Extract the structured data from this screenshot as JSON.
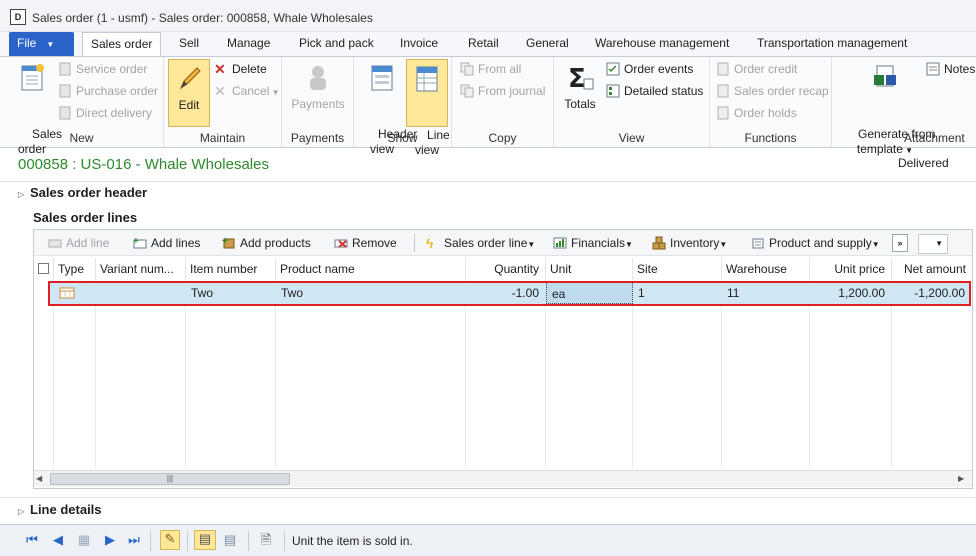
{
  "window": {
    "title": "Sales order (1 - usmf) - Sales order: 000858, Whale Wholesales",
    "app_icon": "ax-app-icon"
  },
  "tabs": [
    "File",
    "Sales order",
    "Sell",
    "Manage",
    "Pick and pack",
    "Invoice",
    "Retail",
    "General",
    "Warehouse management",
    "Transportation management"
  ],
  "ribbon": {
    "new": {
      "label": "New",
      "sales_order": "Sales\norder",
      "service_order": "Service order",
      "purchase_order": "Purchase order",
      "direct_delivery": "Direct delivery"
    },
    "maintain": {
      "label": "Maintain",
      "edit": "Edit",
      "delete": "Delete",
      "cancel": "Cancel"
    },
    "payments": {
      "label": "Payments",
      "payments": "Payments"
    },
    "show": {
      "label": "Show",
      "header_view": "Header\nview",
      "line_view": "Line\nview"
    },
    "copy": {
      "label": "Copy",
      "from_all": "From all",
      "from_journal": "From journal"
    },
    "view": {
      "label": "View",
      "totals": "Totals",
      "order_events": "Order events",
      "detailed_status": "Detailed status"
    },
    "functions": {
      "label": "Functions",
      "order_credit": "Order credit",
      "sales_order_recap": "Sales order recap",
      "order_holds": "Order holds"
    },
    "attachments": {
      "label": "Attachment",
      "generate": "Generate from\ntemplate",
      "notes": "Notes"
    }
  },
  "form": {
    "title": "000858 : US-016 - Whale Wholesales",
    "status": "Delivered",
    "header_section": "Sales order header",
    "lines_section": "Sales order lines",
    "line_details": "Line details"
  },
  "lines_toolbar": {
    "add_line": "Add line",
    "add_lines": "Add lines",
    "add_products": "Add products",
    "remove": "Remove",
    "sales_order_line": "Sales order line",
    "financials": "Financials",
    "inventory": "Inventory",
    "product_and_supply": "Product and supply"
  },
  "grid": {
    "columns": [
      "Type",
      "Variant num...",
      "Item number",
      "Product name",
      "Quantity",
      "Unit",
      "Site",
      "Warehouse",
      "Unit price",
      "Net amount"
    ],
    "rows": [
      {
        "type": "",
        "variant": "",
        "item_number": "Two",
        "product_name": "Two",
        "quantity": "-1.00",
        "unit": "ea",
        "site": "1",
        "warehouse": "11",
        "unit_price": "1,200.00",
        "net_amount": "-1,200.00"
      }
    ]
  },
  "statusbar": {
    "help_text": "Unit the item is sold in."
  }
}
